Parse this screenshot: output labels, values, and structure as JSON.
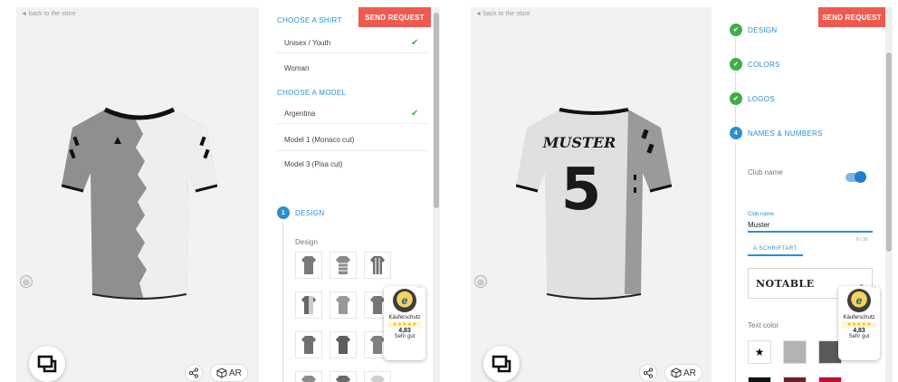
{
  "left": {
    "back_link": "◄ back to the store",
    "send_request": "SEND REQUEST",
    "choose_shirt": "CHOOSE A SHIRT",
    "shirt_options": [
      {
        "label": "Unisex / Youth",
        "selected": true
      },
      {
        "label": "Woman",
        "selected": false
      }
    ],
    "choose_model": "CHOOSE A MODEL",
    "model_options": [
      {
        "label": "Argentina",
        "selected": true
      },
      {
        "label": "Model 1 (Monaco cut)",
        "selected": false
      },
      {
        "label": "Model 3 (Pisa cut)",
        "selected": false
      }
    ],
    "step_design_number": "1",
    "step_design_label": "DESIGN",
    "design_sub_label": "Design",
    "ar_label": "AR",
    "trusted": {
      "icon_letter": "e",
      "label": "Käuferschutz",
      "stars": "★★★★★",
      "rating": "4,83",
      "text": "Sehr gut",
      "more": "···"
    }
  },
  "right": {
    "back_link": "◄ back to the store",
    "send_request": "SEND REQUEST",
    "steps": [
      {
        "label": "DESIGN",
        "done": true
      },
      {
        "label": "COLORS",
        "done": true
      },
      {
        "label": "LOGOS",
        "done": true
      },
      {
        "label": "NAMES & NUMBERS",
        "done": false,
        "number": "4"
      }
    ],
    "club_name_toggle_label": "Club name",
    "club_name_toggle_on": true,
    "club_name_field_label": "Club name",
    "club_name_value": "Muster",
    "char_count": "6 / 30",
    "font_tab": "A SCHRIFTART",
    "font_selected": "NOTABLE",
    "text_color_label": "Text color",
    "shirt_name": "MUSTER",
    "shirt_number": "5",
    "ar_label": "AR",
    "trusted": {
      "icon_letter": "e",
      "label": "Käuferschutz",
      "stars": "★★★★★",
      "rating": "4,83",
      "text": "Sehr gut",
      "more": "···"
    },
    "text_colors": [
      "#ffffff",
      "#b3b3b3",
      "#5a5a5a",
      "#111111",
      "#6e1f2a",
      "#b8142c"
    ]
  },
  "colors": {
    "accent_blue": "#2a8fd0",
    "send_red": "#ef5a50",
    "check_green": "#4caf50"
  }
}
